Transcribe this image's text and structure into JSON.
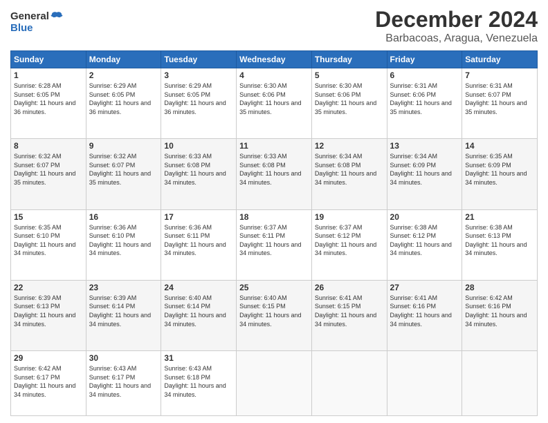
{
  "header": {
    "logo_line1": "General",
    "logo_line2": "Blue",
    "title": "December 2024",
    "subtitle": "Barbacoas, Aragua, Venezuela"
  },
  "weekdays": [
    "Sunday",
    "Monday",
    "Tuesday",
    "Wednesday",
    "Thursday",
    "Friday",
    "Saturday"
  ],
  "weeks": [
    [
      {
        "day": "1",
        "sunrise": "6:28 AM",
        "sunset": "6:05 PM",
        "daylight": "11 hours and 36 minutes."
      },
      {
        "day": "2",
        "sunrise": "6:29 AM",
        "sunset": "6:05 PM",
        "daylight": "11 hours and 36 minutes."
      },
      {
        "day": "3",
        "sunrise": "6:29 AM",
        "sunset": "6:05 PM",
        "daylight": "11 hours and 36 minutes."
      },
      {
        "day": "4",
        "sunrise": "6:30 AM",
        "sunset": "6:06 PM",
        "daylight": "11 hours and 35 minutes."
      },
      {
        "day": "5",
        "sunrise": "6:30 AM",
        "sunset": "6:06 PM",
        "daylight": "11 hours and 35 minutes."
      },
      {
        "day": "6",
        "sunrise": "6:31 AM",
        "sunset": "6:06 PM",
        "daylight": "11 hours and 35 minutes."
      },
      {
        "day": "7",
        "sunrise": "6:31 AM",
        "sunset": "6:07 PM",
        "daylight": "11 hours and 35 minutes."
      }
    ],
    [
      {
        "day": "8",
        "sunrise": "6:32 AM",
        "sunset": "6:07 PM",
        "daylight": "11 hours and 35 minutes."
      },
      {
        "day": "9",
        "sunrise": "6:32 AM",
        "sunset": "6:07 PM",
        "daylight": "11 hours and 35 minutes."
      },
      {
        "day": "10",
        "sunrise": "6:33 AM",
        "sunset": "6:08 PM",
        "daylight": "11 hours and 34 minutes."
      },
      {
        "day": "11",
        "sunrise": "6:33 AM",
        "sunset": "6:08 PM",
        "daylight": "11 hours and 34 minutes."
      },
      {
        "day": "12",
        "sunrise": "6:34 AM",
        "sunset": "6:08 PM",
        "daylight": "11 hours and 34 minutes."
      },
      {
        "day": "13",
        "sunrise": "6:34 AM",
        "sunset": "6:09 PM",
        "daylight": "11 hours and 34 minutes."
      },
      {
        "day": "14",
        "sunrise": "6:35 AM",
        "sunset": "6:09 PM",
        "daylight": "11 hours and 34 minutes."
      }
    ],
    [
      {
        "day": "15",
        "sunrise": "6:35 AM",
        "sunset": "6:10 PM",
        "daylight": "11 hours and 34 minutes."
      },
      {
        "day": "16",
        "sunrise": "6:36 AM",
        "sunset": "6:10 PM",
        "daylight": "11 hours and 34 minutes."
      },
      {
        "day": "17",
        "sunrise": "6:36 AM",
        "sunset": "6:11 PM",
        "daylight": "11 hours and 34 minutes."
      },
      {
        "day": "18",
        "sunrise": "6:37 AM",
        "sunset": "6:11 PM",
        "daylight": "11 hours and 34 minutes."
      },
      {
        "day": "19",
        "sunrise": "6:37 AM",
        "sunset": "6:12 PM",
        "daylight": "11 hours and 34 minutes."
      },
      {
        "day": "20",
        "sunrise": "6:38 AM",
        "sunset": "6:12 PM",
        "daylight": "11 hours and 34 minutes."
      },
      {
        "day": "21",
        "sunrise": "6:38 AM",
        "sunset": "6:13 PM",
        "daylight": "11 hours and 34 minutes."
      }
    ],
    [
      {
        "day": "22",
        "sunrise": "6:39 AM",
        "sunset": "6:13 PM",
        "daylight": "11 hours and 34 minutes."
      },
      {
        "day": "23",
        "sunrise": "6:39 AM",
        "sunset": "6:14 PM",
        "daylight": "11 hours and 34 minutes."
      },
      {
        "day": "24",
        "sunrise": "6:40 AM",
        "sunset": "6:14 PM",
        "daylight": "11 hours and 34 minutes."
      },
      {
        "day": "25",
        "sunrise": "6:40 AM",
        "sunset": "6:15 PM",
        "daylight": "11 hours and 34 minutes."
      },
      {
        "day": "26",
        "sunrise": "6:41 AM",
        "sunset": "6:15 PM",
        "daylight": "11 hours and 34 minutes."
      },
      {
        "day": "27",
        "sunrise": "6:41 AM",
        "sunset": "6:16 PM",
        "daylight": "11 hours and 34 minutes."
      },
      {
        "day": "28",
        "sunrise": "6:42 AM",
        "sunset": "6:16 PM",
        "daylight": "11 hours and 34 minutes."
      }
    ],
    [
      {
        "day": "29",
        "sunrise": "6:42 AM",
        "sunset": "6:17 PM",
        "daylight": "11 hours and 34 minutes."
      },
      {
        "day": "30",
        "sunrise": "6:43 AM",
        "sunset": "6:17 PM",
        "daylight": "11 hours and 34 minutes."
      },
      {
        "day": "31",
        "sunrise": "6:43 AM",
        "sunset": "6:18 PM",
        "daylight": "11 hours and 34 minutes."
      },
      null,
      null,
      null,
      null
    ]
  ]
}
